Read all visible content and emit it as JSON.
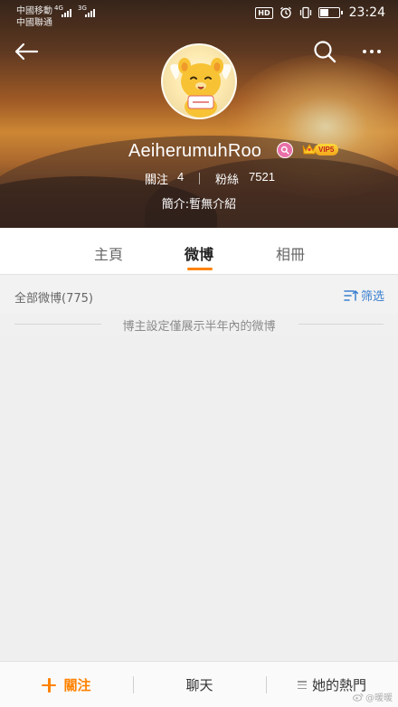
{
  "status_bar": {
    "carrier_1": "中國移動",
    "carrier_2": "中國聯通",
    "network_1": "4G",
    "network_2": "3G",
    "hd_label": "HD",
    "time": "23:24",
    "battery_level": 0.45
  },
  "profile": {
    "username": "AeiherumuhRoo",
    "vip_label": "VIP5",
    "follow_label": "關注",
    "follow_count": "4",
    "fans_label": "粉絲",
    "fans_count": "7521",
    "bio": "簡介:暫無介紹"
  },
  "tabs": [
    {
      "label": "主頁",
      "active": false
    },
    {
      "label": "微博",
      "active": true
    },
    {
      "label": "相冊",
      "active": false
    }
  ],
  "feed": {
    "all_weibo_label": "全部微博(775)",
    "filter_label": "筛选",
    "notice": "博主設定僅展示半年內的微博"
  },
  "bottom_bar": {
    "follow_label": "關注",
    "chat_label": "聊天",
    "hot_label": "她的熱門"
  },
  "watermark": "@暖暖",
  "colors": {
    "accent_orange": "#ff8200",
    "link_blue": "#3a7fcf"
  }
}
